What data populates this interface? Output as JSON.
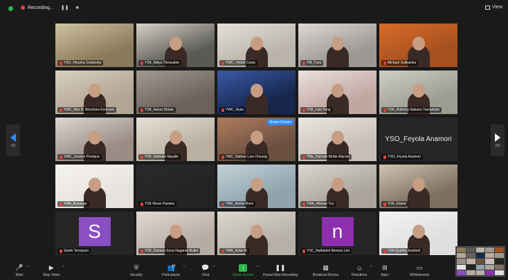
{
  "topbar": {
    "recording_label": "Recording...",
    "pause_glyph": "❚❚",
    "stop_glyph": "■",
    "view_label": "View"
  },
  "navigation": {
    "left_page": "1/2",
    "right_page": "2/2"
  },
  "tiles": [
    {
      "label": "YSO_Hirusha Gollaksha",
      "bg": "#8a7a5c",
      "accent": "#cfc3a1",
      "person": false
    },
    {
      "label": "YSK_Nitiya Thiravatiro",
      "bg": "#5a5a55",
      "accent": "#d8d2c7",
      "person": true
    },
    {
      "label": "YWC_Vinnie Costa",
      "bg": "#b9b3aa",
      "accent": "#e6e1d8",
      "person": true
    },
    {
      "label": "YM_Tusa",
      "bg": "#9c9893",
      "accent": "#dcd9d3",
      "person": true
    },
    {
      "label": "Michael Sulikaiska",
      "bg": "#a4501f",
      "accent": "#d86b2a",
      "person": true
    },
    {
      "label": "YWC_Ben B. Woodrow Emerson",
      "bg": "#b1a594",
      "accent": "#d9d0c0",
      "person": true
    },
    {
      "label": "YSK_Aaron Shirak",
      "bg": "#6c625b",
      "accent": "#a39a90",
      "person": false
    },
    {
      "label": "YWC_Ryan",
      "bg": "#16264c",
      "accent": "#3b5aa8",
      "person": true
    },
    {
      "label": "YSK_Lisa Yang",
      "bg": "#c1a6a1",
      "accent": "#eae1de",
      "person": true
    },
    {
      "label": "YSK_Anthony Nakano Yamamoto",
      "bg": "#9d9c91",
      "accent": "#cfcfc6",
      "person": true
    },
    {
      "label": "YWC_Jocelyn Perdana",
      "bg": "#9a8d86",
      "accent": "#ddd6d1",
      "person": true
    },
    {
      "label": "YSK_Nathalie Maudie",
      "bg": "#b9b0a2",
      "accent": "#e6e0d6",
      "person": true
    },
    {
      "label": "YMC_Nathan Lam Cheung",
      "bg": "#6b5040",
      "accent": "#b07b5d",
      "person": true,
      "speaking": true,
      "speak_tag": "Shows Screen"
    },
    {
      "label": "YMs_Hannah Birdie Warner",
      "bg": "#c8c0b8",
      "accent": "#ebe6e0",
      "person": true
    },
    {
      "label": "YSO_Feyola Anamori",
      "bg": "#262626",
      "accent": "#262626",
      "person": false,
      "bigname": "YSO_Feyola Anamori"
    },
    {
      "label": "YMA_Bunenge",
      "bg": "#e6e3df",
      "accent": "#f5f3f0",
      "person": true
    },
    {
      "label": "YSK Rinan Hasima",
      "bg": "#232323",
      "accent": "#2a2a2a",
      "person": false
    },
    {
      "label": "YMC_Andre Rove",
      "bg": "#8fa4ad",
      "accent": "#c3d1d7",
      "person": true
    },
    {
      "label": "YMA_Alishan Tun",
      "bg": "#aaa49b",
      "accent": "#dcd7cf",
      "person": true
    },
    {
      "label": "YSK_Elaine",
      "bg": "#7d705f",
      "accent": "#cfc4b2",
      "person": true
    },
    {
      "label": "Sarah Tennyson",
      "bg": "#262626",
      "accent": "#262626",
      "person": false,
      "avatar": "S",
      "avatar_color": "#8a4fc2"
    },
    {
      "label": "YSK_Daniela Sona Nagarah Bullet",
      "bg": "#b7aca4",
      "accent": "#e2dad4",
      "person": true
    },
    {
      "label": "YMA_Keke Bi",
      "bg": "#b6b0a6",
      "accent": "#ddd8cf",
      "person": true
    },
    {
      "label": "YSC_Nathaniel Bennes Lim",
      "bg": "#262626",
      "accent": "#262626",
      "person": false,
      "avatar": "n",
      "avatar_color": "#8e2fb0"
    },
    {
      "label": "YSA Quinha Josebell",
      "bg": "#dedede",
      "accent": "#f4f4f4",
      "person": true
    }
  ],
  "toolbar": [
    {
      "label": "Mute",
      "icon": "🎤",
      "name": "mute-button",
      "caret": true
    },
    {
      "label": "Stop Video",
      "icon": "▶",
      "name": "stop-video-button",
      "caret": true
    },
    {
      "label": "Security",
      "icon": "⛨",
      "name": "security-button"
    },
    {
      "label": "Participants",
      "icon": "👥",
      "name": "participants-button",
      "caret": true,
      "count": "44"
    },
    {
      "label": "Chat",
      "icon": "💬",
      "name": "chat-button",
      "caret": true
    },
    {
      "label": "Share Screen",
      "icon": "↑",
      "name": "share-screen-button",
      "caret": true,
      "green": true
    },
    {
      "label": "Pause/Stop Recording",
      "icon": "❚❚",
      "name": "pause-recording-button"
    },
    {
      "label": "Breakout Rooms",
      "icon": "▦",
      "name": "breakout-rooms-button"
    },
    {
      "label": "Reactions",
      "icon": "☺",
      "name": "reactions-button",
      "caret": true
    },
    {
      "label": "Apps",
      "icon": "⊞",
      "name": "apps-button"
    },
    {
      "label": "Whiteboards",
      "icon": "▭",
      "name": "whiteboards-button"
    }
  ]
}
